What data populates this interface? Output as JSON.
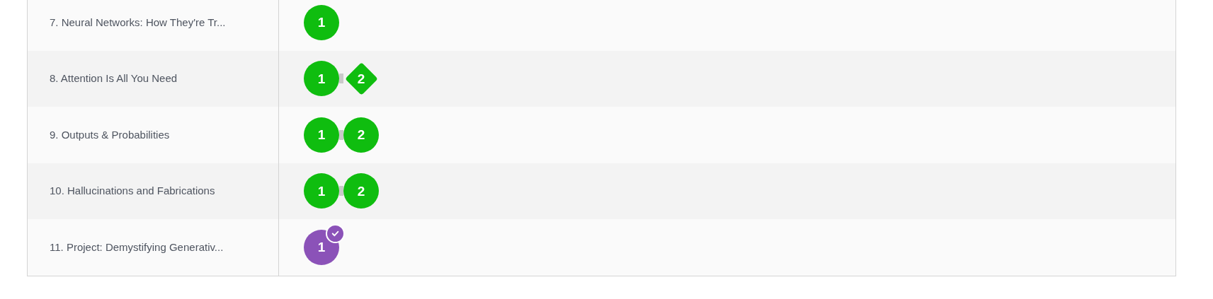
{
  "rows": [
    {
      "title": "7. Neural Networks: How They're Tr...",
      "steps": [
        {
          "label": "1",
          "kind": "circle",
          "color": "#0fbd0f",
          "completed": false
        }
      ]
    },
    {
      "title": "8. Attention Is All You Need",
      "steps": [
        {
          "label": "1",
          "kind": "circle",
          "color": "#0fbd0f",
          "completed": false
        },
        {
          "label": "2",
          "kind": "diamond",
          "color": "#0fbd0f",
          "completed": false
        }
      ]
    },
    {
      "title": "9. Outputs & Probabilities",
      "steps": [
        {
          "label": "1",
          "kind": "circle",
          "color": "#0fbd0f",
          "completed": false
        },
        {
          "label": "2",
          "kind": "circle",
          "color": "#0fbd0f",
          "completed": false
        }
      ]
    },
    {
      "title": "10. Hallucinations and Fabrications",
      "steps": [
        {
          "label": "1",
          "kind": "circle",
          "color": "#0fbd0f",
          "completed": false
        },
        {
          "label": "2",
          "kind": "circle",
          "color": "#0fbd0f",
          "completed": false
        }
      ]
    },
    {
      "title": "11. Project: Demystifying Generativ...",
      "steps": [
        {
          "label": "1",
          "kind": "circle",
          "color": "#8b52b8",
          "completed": true
        }
      ]
    }
  ]
}
